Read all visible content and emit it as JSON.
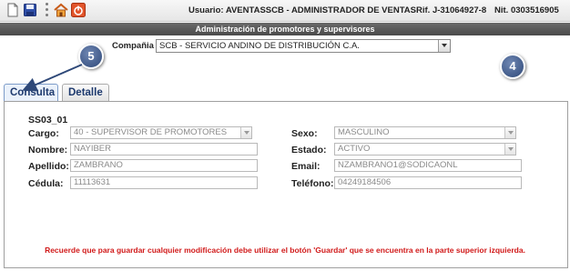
{
  "toolbar": {
    "user_label": "Usuario: AVENTASSCB - ADMINISTRADOR DE VENTAS",
    "rif": "Rif. J-31064927-8",
    "nit": "Nit. 0303516905",
    "icons": [
      "new-document-icon",
      "save-disk-icon",
      "home-icon",
      "power-exit-icon"
    ]
  },
  "title": "Administración de promotores y supervisores",
  "company": {
    "label": "Compañia :",
    "value": "SCB - SERVICIO ANDINO DE DISTRIBUCIÓN C.A."
  },
  "callouts": {
    "five": "5",
    "four": "4"
  },
  "tabs": [
    {
      "label": "Consulta",
      "active": true
    },
    {
      "label": "Detalle",
      "active": false
    }
  ],
  "record": {
    "code": "SS03_01",
    "left": [
      {
        "label": "Cargo:",
        "value": "40 - SUPERVISOR DE PROMOTORES",
        "type": "select"
      },
      {
        "label": "Nombre:",
        "value": "NAYIBER",
        "type": "text"
      },
      {
        "label": "Apellido:",
        "value": "ZAMBRANO",
        "type": "text"
      },
      {
        "label": "Cédula:",
        "value": "11113631",
        "type": "text"
      }
    ],
    "right": [
      {
        "label": "Sexo:",
        "value": "MASCULINO",
        "type": "select"
      },
      {
        "label": "Estado:",
        "value": "ACTIVO",
        "type": "select"
      },
      {
        "label": "Email:",
        "value": "NZAMBRANO1@SODICAONL",
        "type": "text"
      },
      {
        "label": "Teléfono:",
        "value": "04249184506",
        "type": "text"
      }
    ]
  },
  "note": "Recuerde que para guardar cualquier modificación debe utilizar el botón 'Guardar' que se encuentra en la parte superior izquierda.",
  "colors": {
    "callout": "#3b5688",
    "note": "#d11a1a",
    "title_bar": "#555555",
    "tab_text": "#1e3a6e"
  }
}
